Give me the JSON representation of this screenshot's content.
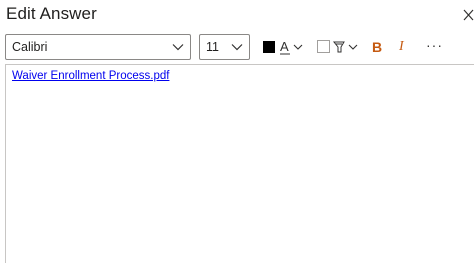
{
  "dialog": {
    "title": "Edit Answer",
    "close_glyph": "╳"
  },
  "toolbar": {
    "font_family": "Calibri",
    "font_size": "11",
    "font_color_letter": "A",
    "font_color_value": "#000000",
    "bold_label": "B",
    "italic_label": "I",
    "more_label": "···",
    "accent_color": "#c55a11"
  },
  "editor": {
    "attachment_link": "Waiver Enrollment Process.pdf"
  }
}
